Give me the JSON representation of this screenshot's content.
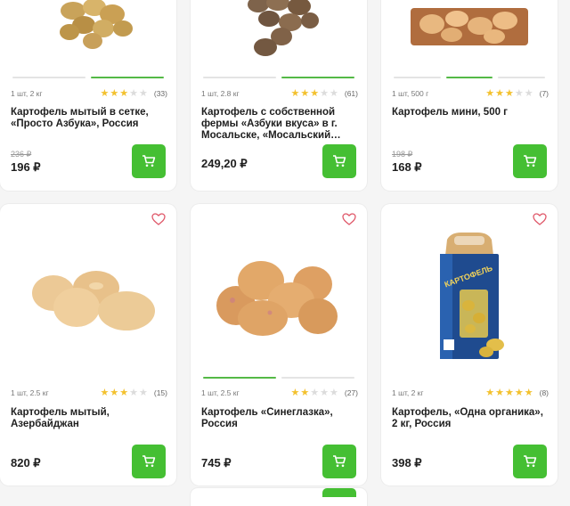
{
  "colors": {
    "accent": "#45bf33",
    "star": "#f3c12e",
    "heart": "#e05a6b"
  },
  "cards": [
    {
      "row": 1,
      "col": 1,
      "tabs": [
        false,
        true
      ],
      "meta": "1 шт, 2 кг",
      "rating": 3,
      "reviews": "(33)",
      "title": "Картофель мытый в сетке, «Просто Азбука», Россия",
      "old_price": "236 ₽",
      "price": "196 ₽",
      "favorite": false
    },
    {
      "row": 1,
      "col": 2,
      "tabs": [
        false,
        true
      ],
      "meta": "1 шт, 2.8 кг",
      "rating": 3,
      "reviews": "(61)",
      "title": "Картофель с собственной фермы «Азбуки вкуса» в г. Мосальске, «Мосальский…",
      "old_price": "",
      "price": "249,20 ₽",
      "favorite": false
    },
    {
      "row": 1,
      "col": 3,
      "tabs": [
        false,
        true,
        false
      ],
      "meta": "1 шт, 500 г",
      "rating": 3,
      "reviews": "(7)",
      "title": "Картофель мини, 500 г",
      "old_price": "198 ₽",
      "price": "168 ₽",
      "favorite": false
    },
    {
      "row": 2,
      "col": 1,
      "tabs": [],
      "meta": "1 шт, 2.5 кг",
      "rating": 3,
      "reviews": "(15)",
      "title": "Картофель мытый, Азербайджан",
      "old_price": "",
      "price": "820 ₽",
      "favorite": true
    },
    {
      "row": 2,
      "col": 2,
      "tabs": [
        true,
        false
      ],
      "meta": "1 шт, 2.5 кг",
      "rating": 2,
      "reviews": "(27)",
      "title": "Картофель «Синеглазка», Россия",
      "old_price": "",
      "price": "745 ₽",
      "favorite": true
    },
    {
      "row": 2,
      "col": 3,
      "tabs": [],
      "meta": "1 шт, 2 кг",
      "rating": 5,
      "reviews": "(8)",
      "title": "Картофель, «Одна органика», 2 кг, Россия",
      "old_price": "",
      "price": "398 ₽",
      "favorite": true
    }
  ],
  "bag_label": "КАРТОФЕЛЬ",
  "icons": {
    "cart": "cart-icon",
    "heart": "heart-icon",
    "star": "star-icon"
  }
}
